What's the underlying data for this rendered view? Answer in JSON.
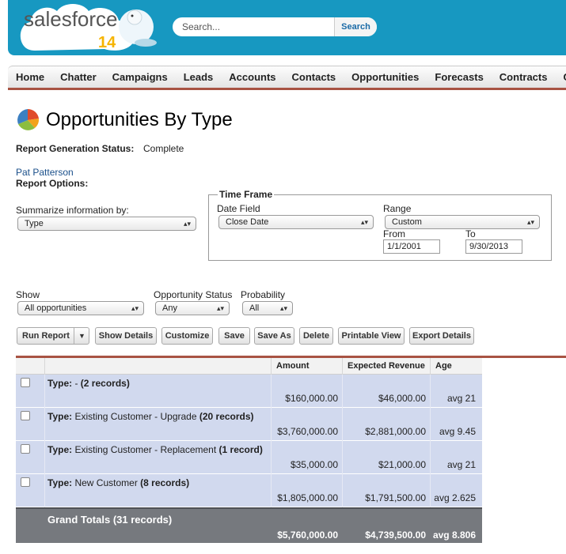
{
  "brand": {
    "name": "salesforce",
    "badge": "14"
  },
  "search": {
    "placeholder": "Search...",
    "button": "Search"
  },
  "nav": {
    "tabs": [
      "Home",
      "Chatter",
      "Campaigns",
      "Leads",
      "Accounts",
      "Contacts",
      "Opportunities",
      "Forecasts",
      "Contracts",
      "C"
    ]
  },
  "page": {
    "title": "Opportunities By Type",
    "status_label": "Report Generation Status:",
    "status_value": "Complete",
    "user": "Pat Patterson",
    "options_label": "Report Options:"
  },
  "options": {
    "summarize_label": "Summarize information by:",
    "summarize_value": "Type",
    "timeframe_legend": "Time Frame",
    "date_field_label": "Date Field",
    "date_field_value": "Close Date",
    "range_label": "Range",
    "range_value": "Custom",
    "from_label": "From",
    "from_value": "1/1/2001",
    "to_label": "To",
    "to_value": "9/30/2013",
    "show_label": "Show",
    "show_value": "All opportunities",
    "status_label": "Opportunity Status",
    "status_value": "Any",
    "probability_label": "Probability",
    "probability_value": "All"
  },
  "buttons": {
    "run_report": "Run Report",
    "show_details": "Show Details",
    "customize": "Customize",
    "save": "Save",
    "save_as": "Save As",
    "delete": "Delete",
    "printable_view": "Printable View",
    "export_details": "Export Details"
  },
  "table": {
    "headers": [
      "Amount",
      "Expected Revenue",
      "Age"
    ],
    "groups": [
      {
        "label": "Type:",
        "value": " - ",
        "count": "(2 records)",
        "amount": "$160,000.00",
        "expected": "$46,000.00",
        "age": "avg 21"
      },
      {
        "label": "Type:",
        "value": " Existing Customer - Upgrade ",
        "count": "(20 records)",
        "amount": "$3,760,000.00",
        "expected": "$2,881,000.00",
        "age": "avg 9.45"
      },
      {
        "label": "Type:",
        "value": " Existing Customer - Replacement ",
        "count": "(1 record)",
        "amount": "$35,000.00",
        "expected": "$21,000.00",
        "age": "avg 21"
      },
      {
        "label": "Type:",
        "value": " New Customer ",
        "count": "(8 records)",
        "amount": "$1,805,000.00",
        "expected": "$1,791,500.00",
        "age": "avg 2.625"
      }
    ],
    "totals": {
      "label": "Grand Totals (31 records)",
      "amount": "$5,760,000.00",
      "expected": "$4,739,500.00",
      "age": "avg 8.806"
    }
  },
  "colors": {
    "header": "#1798c1",
    "nav_accent": "#a85343",
    "group_row": "#d1d9ee",
    "totals_row": "#76797e",
    "link": "#1a4f8a"
  }
}
